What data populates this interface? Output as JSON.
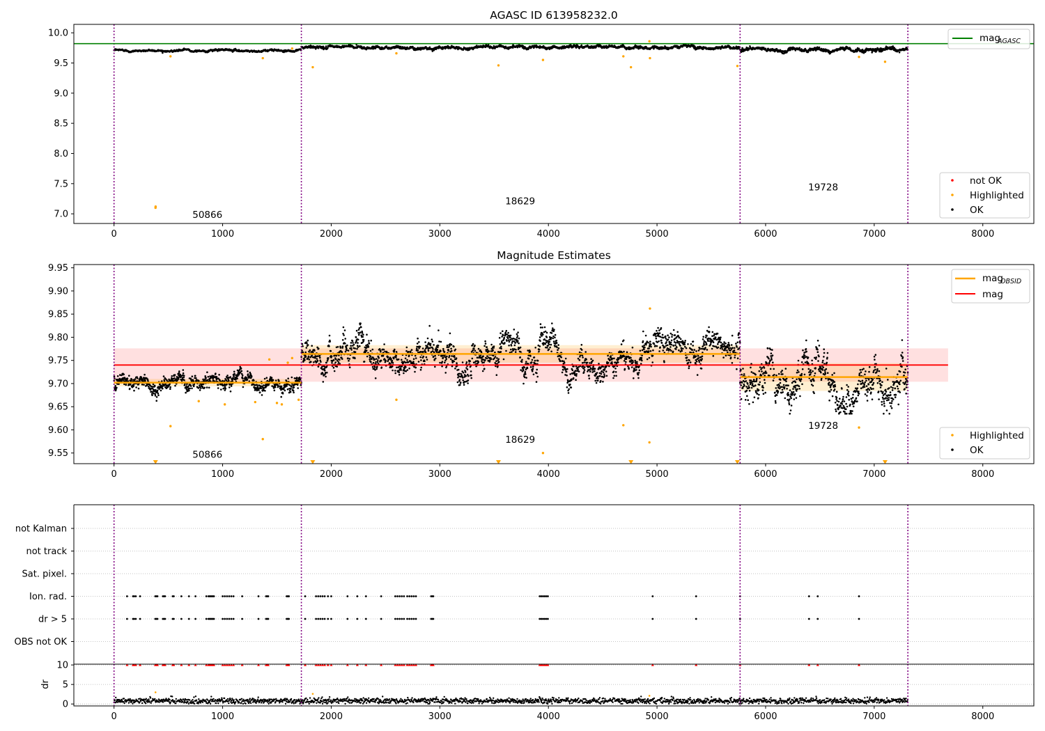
{
  "chart_data": [
    {
      "type": "scatter",
      "title": "AGASC ID 613958232.0",
      "xlim": [
        -370,
        8470
      ],
      "ylim": [
        6.84,
        10.14
      ],
      "x_ticks": [
        0,
        1000,
        2000,
        3000,
        4000,
        5000,
        6000,
        7000,
        8000
      ],
      "y_ticks": [
        7.0,
        7.5,
        8.0,
        8.5,
        9.0,
        9.5,
        10.0
      ],
      "grid": false,
      "reference_line": {
        "name_main": "mag",
        "name_sub": "AGASC",
        "y": 9.82,
        "color": "#008000"
      },
      "obsid_boundaries": [
        0,
        1725,
        5765,
        7310
      ],
      "obsid_labels": [
        {
          "text": "50866",
          "x": 860,
          "y": 6.93
        },
        {
          "text": "18629",
          "x": 3740,
          "y": 7.16
        },
        {
          "text": "19728",
          "x": 6530,
          "y": 7.39
        }
      ],
      "series": [
        {
          "name": "OK",
          "color": "#000000",
          "segments": [
            {
              "x0": 0,
              "x1": 1725,
              "mean": 9.708,
              "sd": 0.012
            },
            {
              "x0": 1725,
              "x1": 5765,
              "mean": 9.764,
              "sd": 0.018
            },
            {
              "x0": 5765,
              "x1": 7310,
              "mean": 9.714,
              "sd": 0.022
            }
          ]
        },
        {
          "name": "Highlighted",
          "color": "#ffa500",
          "points": [
            [
              382,
              7.1
            ],
            [
              383,
              7.12
            ],
            [
              520,
              9.61
            ],
            [
              1370,
              9.58
            ],
            [
              1640,
              9.74
            ],
            [
              1830,
              9.43
            ],
            [
              2600,
              9.66
            ],
            [
              3540,
              9.46
            ],
            [
              3950,
              9.55
            ],
            [
              4690,
              9.61
            ],
            [
              4760,
              9.43
            ],
            [
              4930,
              9.86
            ],
            [
              4935,
              9.58
            ],
            [
              5740,
              9.45
            ],
            [
              6860,
              9.6
            ],
            [
              7100,
              9.52
            ]
          ]
        },
        {
          "name": "not OK",
          "color": "#ff0000",
          "points": []
        }
      ],
      "legend": [
        {
          "position": "upper-right",
          "entries": [
            "mag_AGASC"
          ]
        },
        {
          "position": "lower-right",
          "entries": [
            "not OK",
            "Highlighted",
            "OK"
          ]
        }
      ]
    },
    {
      "type": "scatter",
      "title": "Magnitude Estimates",
      "xlim": [
        -370,
        8470
      ],
      "ylim": [
        9.527,
        9.957
      ],
      "x_ticks": [
        0,
        1000,
        2000,
        3000,
        4000,
        5000,
        6000,
        7000,
        8000
      ],
      "y_ticks": [
        9.55,
        9.6,
        9.65,
        9.7,
        9.75,
        9.8,
        9.85,
        9.9,
        9.95
      ],
      "grid": false,
      "mag_line": {
        "name": "mag",
        "y": 9.74,
        "band": [
          9.704,
          9.776
        ],
        "x0": 0,
        "x1": 7680,
        "color": "#ff0000"
      },
      "mag_obsid": {
        "name_main": "mag",
        "name_sub": "OBSID",
        "color": "#ffa500",
        "segments": [
          {
            "x0": 0,
            "x1": 1725,
            "y": 9.702,
            "band": [
              9.694,
              9.71
            ]
          },
          {
            "x0": 1725,
            "x1": 5765,
            "y": 9.764,
            "band": [
              9.745,
              9.783
            ]
          },
          {
            "x0": 5765,
            "x1": 7310,
            "y": 9.714,
            "band": [
              9.684,
              9.744
            ]
          }
        ]
      },
      "obsid_boundaries": [
        0,
        1725,
        5765,
        7310
      ],
      "obsid_labels": [
        {
          "text": "50866",
          "x": 860,
          "y": 9.54
        },
        {
          "text": "18629",
          "x": 3740,
          "y": 9.572
        },
        {
          "text": "19728",
          "x": 6530,
          "y": 9.602
        }
      ],
      "series": [
        {
          "name": "OK",
          "color": "#000000",
          "segments": [
            {
              "x0": 0,
              "x1": 1725,
              "mean": 9.705,
              "sd": 0.011
            },
            {
              "x0": 1725,
              "x1": 5765,
              "mean": 9.762,
              "sd": 0.022
            },
            {
              "x0": 5765,
              "x1": 7310,
              "mean": 9.712,
              "sd": 0.03
            }
          ]
        },
        {
          "name": "Highlighted",
          "color": "#ffa500",
          "points": [
            [
              520,
              9.608
            ],
            [
              780,
              9.662
            ],
            [
              1020,
              9.655
            ],
            [
              1300,
              9.66
            ],
            [
              1370,
              9.58
            ],
            [
              1430,
              9.752
            ],
            [
              1500,
              9.658
            ],
            [
              1545,
              9.655
            ],
            [
              1600,
              9.745
            ],
            [
              1640,
              9.755
            ],
            [
              1700,
              9.665
            ],
            [
              2600,
              9.665
            ],
            [
              3950,
              9.55
            ],
            [
              4690,
              9.61
            ],
            [
              4935,
              9.862
            ],
            [
              4930,
              9.573
            ],
            [
              6860,
              9.605
            ]
          ]
        },
        {
          "name": "Highlighted (below range)",
          "color": "#ffa500",
          "marker": "triangle-down",
          "points": [
            [
              382,
              9.53
            ],
            [
              1830,
              9.53
            ],
            [
              3540,
              9.53
            ],
            [
              4760,
              9.53
            ],
            [
              5740,
              9.53
            ],
            [
              7100,
              9.53
            ]
          ]
        }
      ],
      "legend": [
        {
          "position": "upper-right",
          "entries": [
            "mag_OBSID",
            "mag"
          ]
        },
        {
          "position": "lower-right",
          "entries": [
            "Highlighted",
            "OK"
          ]
        }
      ]
    },
    {
      "type": "scatter",
      "title": "",
      "xlim": [
        -370,
        8470
      ],
      "x_ticks": [
        0,
        1000,
        2000,
        3000,
        4000,
        5000,
        6000,
        7000,
        8000
      ],
      "flag_rows": [
        "not Kalman",
        "not track",
        "Sat. pixel.",
        "Ion. rad.",
        "dr > 5",
        "OBS not OK"
      ],
      "flag_points": {
        "Ion. rad.": [
          120,
          175,
          185,
          200,
          240,
          380,
          390,
          400,
          450,
          460,
          470,
          540,
          550,
          620,
          690,
          750,
          850,
          870,
          880,
          890,
          900,
          910,
          920,
          1000,
          1020,
          1040,
          1060,
          1080,
          1100,
          1180,
          1330,
          1400,
          1410,
          1420,
          1590,
          1600,
          1610,
          1760,
          1860,
          1880,
          1900,
          1920,
          1940,
          1970,
          2000,
          2150,
          2240,
          2320,
          2460,
          2590,
          2610,
          2630,
          2650,
          2670,
          2700,
          2720,
          2740,
          2760,
          2780,
          2920,
          2930,
          2940,
          3920,
          3935,
          3950,
          3965,
          3980,
          3995,
          4960,
          5360,
          5765,
          6400,
          6480,
          6860
        ],
        "dr > 5": [
          120,
          175,
          185,
          200,
          240,
          380,
          390,
          400,
          450,
          460,
          470,
          540,
          550,
          620,
          690,
          750,
          850,
          870,
          880,
          890,
          900,
          910,
          920,
          1000,
          1020,
          1040,
          1060,
          1080,
          1100,
          1180,
          1330,
          1400,
          1410,
          1420,
          1590,
          1600,
          1610,
          1760,
          1860,
          1880,
          1900,
          1920,
          1940,
          1970,
          2000,
          2150,
          2240,
          2320,
          2460,
          2590,
          2610,
          2630,
          2650,
          2670,
          2700,
          2720,
          2740,
          2760,
          2780,
          2920,
          2930,
          2940,
          3920,
          3935,
          3950,
          3965,
          3980,
          3995,
          4960,
          5360,
          5765,
          6400,
          6480,
          6860
        ]
      },
      "obsid_boundaries": [
        0,
        1725,
        5765,
        7310
      ]
    },
    {
      "type": "scatter",
      "title": "",
      "ylabel": "dr",
      "xlim": [
        -370,
        8470
      ],
      "ylim": [
        -0.5,
        10.2
      ],
      "x_ticks": [
        0,
        1000,
        2000,
        3000,
        4000,
        5000,
        6000,
        7000,
        8000
      ],
      "y_ticks": [
        0,
        5,
        10
      ],
      "grid": false,
      "obsid_boundaries": [
        0,
        1725,
        5765,
        7310
      ],
      "series": [
        {
          "name": "dr",
          "color": "#000000",
          "mean": 0.8,
          "sd": 0.35
        },
        {
          "name": "dr > 5 (clipped)",
          "color": "#ff0000",
          "marker": "triangle-up",
          "y": 10,
          "same_x_as": "dr > 5"
        },
        {
          "name": "Highlighted",
          "color": "#ffa500",
          "points": [
            [
              382,
              3.0
            ],
            [
              1830,
              2.6
            ],
            [
              4930,
              2.1
            ]
          ]
        }
      ]
    }
  ]
}
